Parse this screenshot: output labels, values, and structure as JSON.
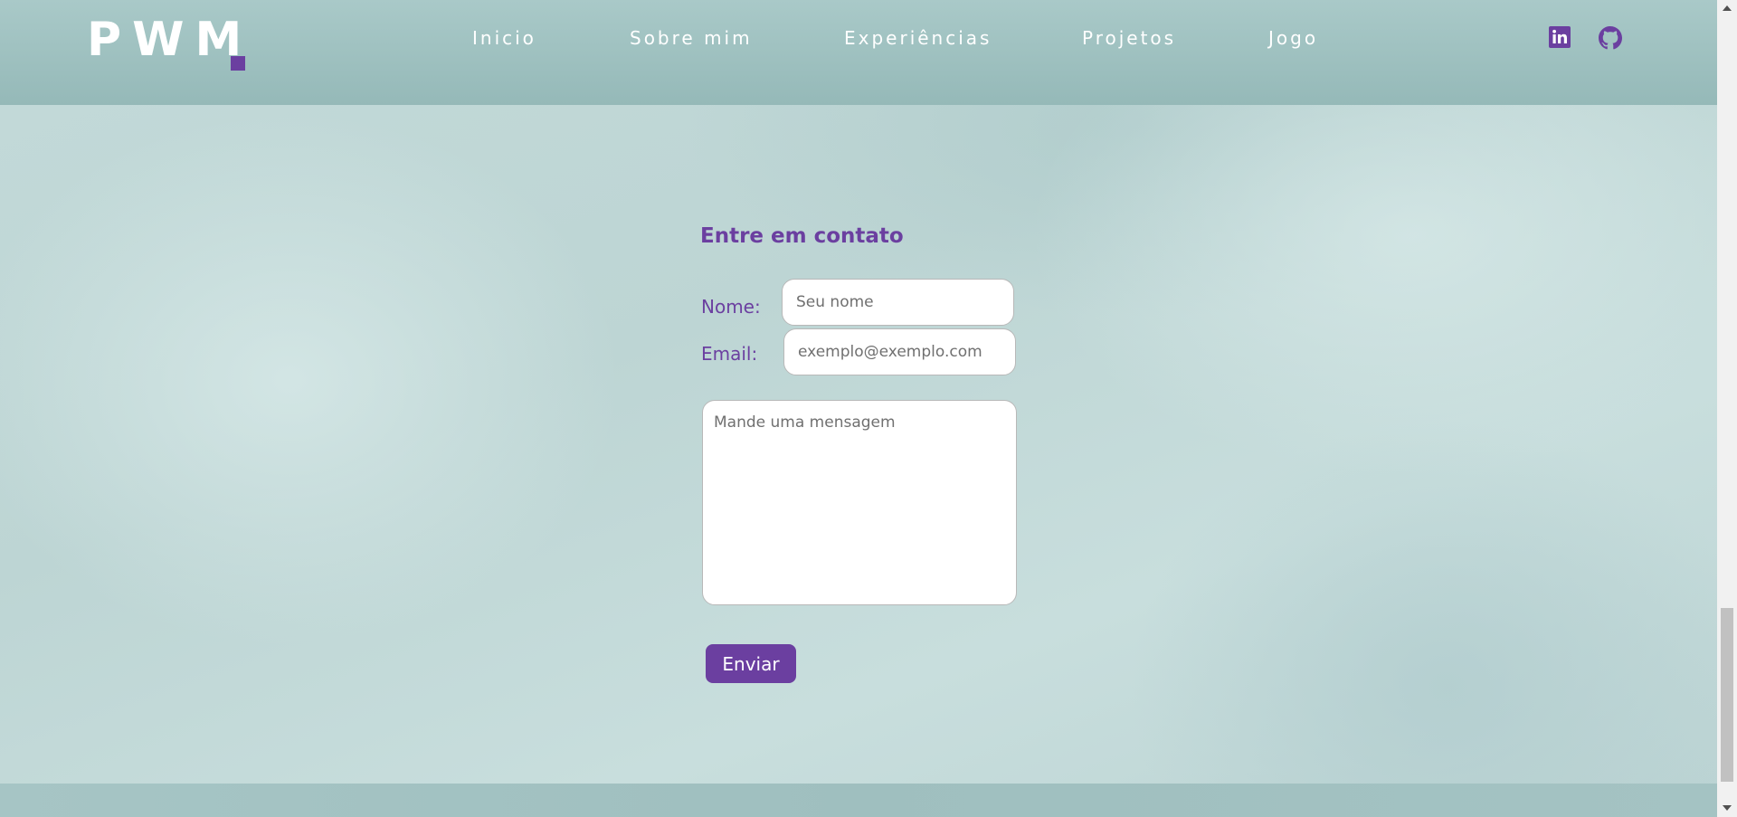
{
  "header": {
    "logo_text": "PWM",
    "nav": [
      {
        "label": "Inicio"
      },
      {
        "label": "Sobre mim"
      },
      {
        "label": "Experiências"
      },
      {
        "label": "Projetos"
      },
      {
        "label": "Jogo"
      }
    ],
    "social": [
      {
        "icon": "linkedin-icon"
      },
      {
        "icon": "github-icon"
      }
    ]
  },
  "contact": {
    "title": "Entre em contato",
    "name_label": "Nome:",
    "name_placeholder": "Seu nome",
    "email_label": "Email:",
    "email_placeholder": "exemplo@exemplo.com",
    "message_placeholder": "Mande uma mensagem",
    "submit_label": "Enviar"
  },
  "colors": {
    "accent": "#6b3fa0",
    "header_bg": "#9bbebd",
    "page_bg": "#c5dcdb"
  }
}
